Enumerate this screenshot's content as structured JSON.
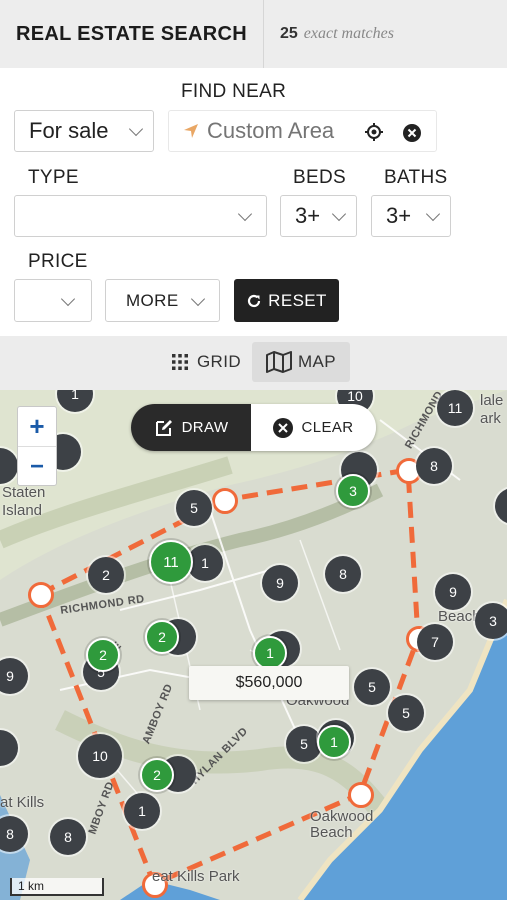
{
  "header": {
    "title": "REAL ESTATE SEARCH",
    "match_count": "25",
    "match_suffix": "exact matches"
  },
  "filters": {
    "listing_type": {
      "value": "For sale"
    },
    "find_near": {
      "label": "FIND NEAR",
      "placeholder": "Custom Area"
    },
    "type": {
      "label": "TYPE",
      "value": ""
    },
    "beds": {
      "label": "BEDS",
      "value": "3+"
    },
    "baths": {
      "label": "BATHS",
      "value": "3+"
    },
    "price": {
      "label": "PRICE",
      "value": ""
    },
    "more_label": "MORE",
    "reset_label": "RESET"
  },
  "view": {
    "grid_label": "GRID",
    "map_label": "MAP",
    "active": "map"
  },
  "map": {
    "zoom_in": "+",
    "zoom_out": "−",
    "draw_label": "DRAW",
    "clear_label": "CLEAR",
    "price_popup": "$560,000",
    "scale_label": "1 km",
    "places": [
      "Staten",
      "Island",
      "Oakwood",
      "Oakwood",
      "Beach",
      "at Kills",
      "eat Kills Park",
      "Beach",
      "lale",
      "ark"
    ],
    "roads": [
      "RICHMOND RD",
      "RICHMOND",
      "AMBOY RD",
      "HYLAN BLVD",
      "MBOY RD",
      "AVE"
    ],
    "clusters": [
      "1",
      "10",
      "5",
      "11",
      "1",
      "3",
      "8",
      "11",
      "5",
      "2",
      "1",
      "9",
      "8",
      "9",
      "3",
      "2",
      "5",
      "9",
      "2",
      "1",
      "5",
      "5",
      "1",
      "10",
      "2",
      "5",
      "1",
      "8",
      "8",
      "7"
    ],
    "colors": {
      "accent": "#f06a3a",
      "cluster_dark": "#3d4146",
      "cluster_green": "#2f9a3c",
      "water": "#5fa0d8"
    }
  }
}
